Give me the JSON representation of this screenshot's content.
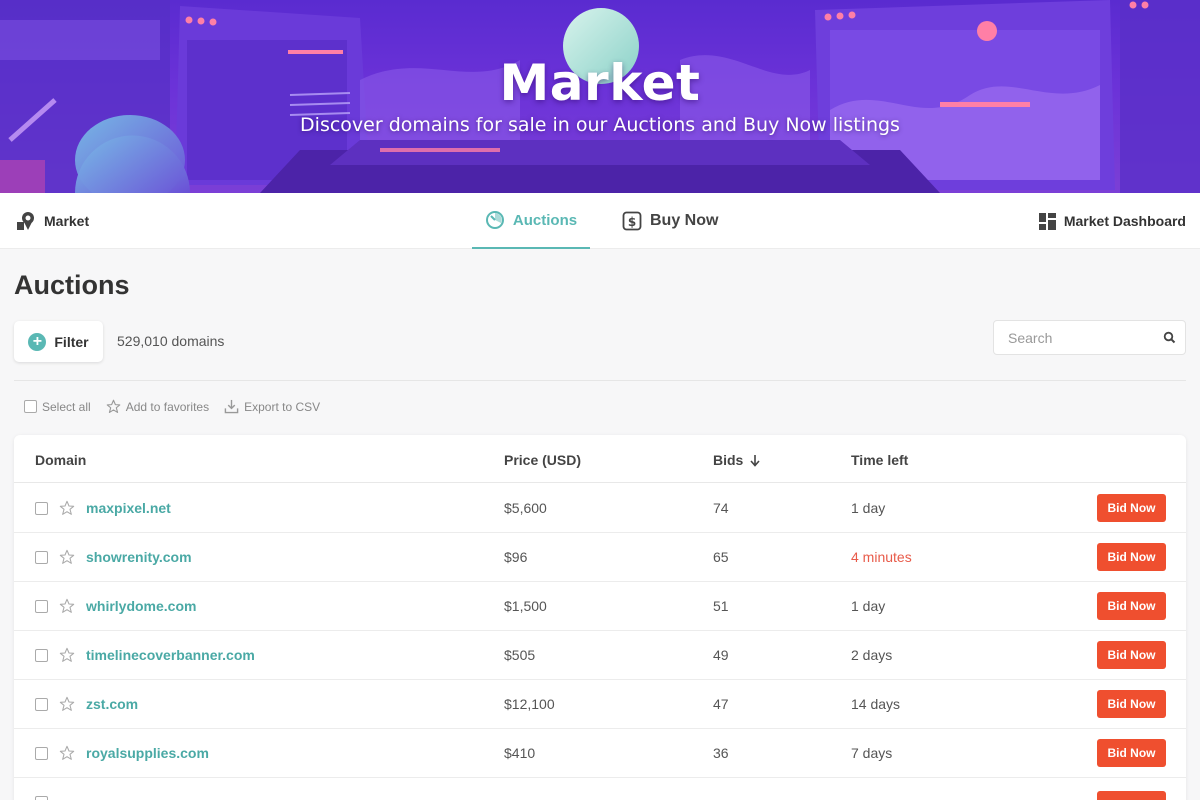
{
  "hero": {
    "title": "Market",
    "subtitle": "Discover domains for sale in our Auctions and Buy Now listings"
  },
  "nav": {
    "left_label": "Market",
    "left_icon": "market-pin-icon",
    "tabs": [
      {
        "label": "Auctions",
        "icon": "timer-icon",
        "active": true
      },
      {
        "label": "Buy Now",
        "icon": "dollar-tag-icon",
        "active": false
      }
    ],
    "right_label": "Market Dashboard",
    "right_icon": "dashboard-grid-icon"
  },
  "main": {
    "title": "Auctions",
    "filter_label": "Filter",
    "domain_count": "529,010 domains",
    "search_placeholder": "Search"
  },
  "actions": {
    "select_all": "Select all",
    "add_favorites": "Add to favorites",
    "export_csv": "Export to CSV"
  },
  "table": {
    "columns": {
      "domain": "Domain",
      "price": "Price (USD)",
      "bids": "Bids",
      "time_left": "Time left"
    },
    "sort_column": "bids",
    "bid_label": "Bid Now",
    "rows": [
      {
        "domain": "maxpixel.net",
        "price": "$5,600",
        "bids": "74",
        "time": "1 day",
        "urgent": false
      },
      {
        "domain": "showrenity.com",
        "price": "$96",
        "bids": "65",
        "time": "4 minutes",
        "urgent": true
      },
      {
        "domain": "whirlydome.com",
        "price": "$1,500",
        "bids": "51",
        "time": "1 day",
        "urgent": false
      },
      {
        "domain": "timelinecoverbanner.com",
        "price": "$505",
        "bids": "49",
        "time": "2 days",
        "urgent": false
      },
      {
        "domain": "zst.com",
        "price": "$12,100",
        "bids": "47",
        "time": "14 days",
        "urgent": false
      },
      {
        "domain": "royalsupplies.com",
        "price": "$410",
        "bids": "36",
        "time": "7 days",
        "urgent": false
      }
    ]
  },
  "colors": {
    "accent": "#5ab8b4",
    "bid_button": "#ef4f2f",
    "urgent_time": "#e85b4a",
    "hero_purple": "#6b32d8"
  }
}
